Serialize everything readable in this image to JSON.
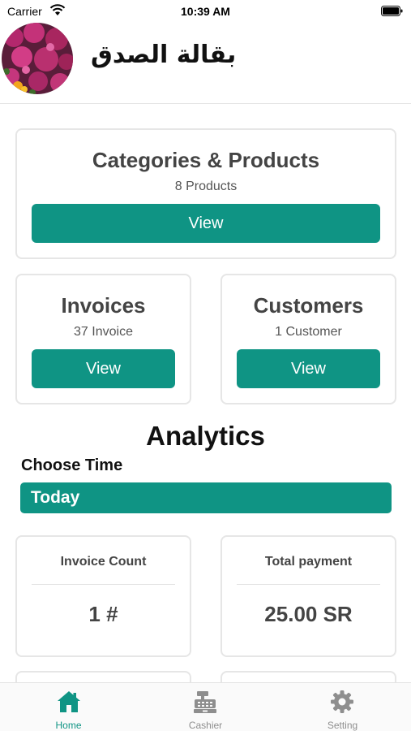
{
  "status_bar": {
    "carrier": "Carrier",
    "time": "10:39 AM"
  },
  "header": {
    "store_name": "بقالة الصدق"
  },
  "categories_card": {
    "title": "Categories & Products",
    "subtitle": "8 Products",
    "button_label": "View"
  },
  "invoices_card": {
    "title": "Invoices",
    "subtitle": "37 Invoice",
    "button_label": "View"
  },
  "customers_card": {
    "title": "Customers",
    "subtitle": "1 Customer",
    "button_label": "View"
  },
  "analytics": {
    "title": "Analytics",
    "choose_time_label": "Choose Time",
    "selected_time": "Today",
    "stats": [
      {
        "label": "Invoice Count",
        "value": "1 #"
      },
      {
        "label": "Total payment",
        "value": "25.00 SR"
      }
    ]
  },
  "tab_bar": {
    "tabs": [
      {
        "label": "Home",
        "icon": "home-icon",
        "active": true
      },
      {
        "label": "Cashier",
        "icon": "cash-register-icon",
        "active": false
      },
      {
        "label": "Setting",
        "icon": "gear-icon",
        "active": false
      }
    ]
  },
  "colors": {
    "accent": "#0f9484",
    "inactive_tab": "#8e8e8e"
  }
}
